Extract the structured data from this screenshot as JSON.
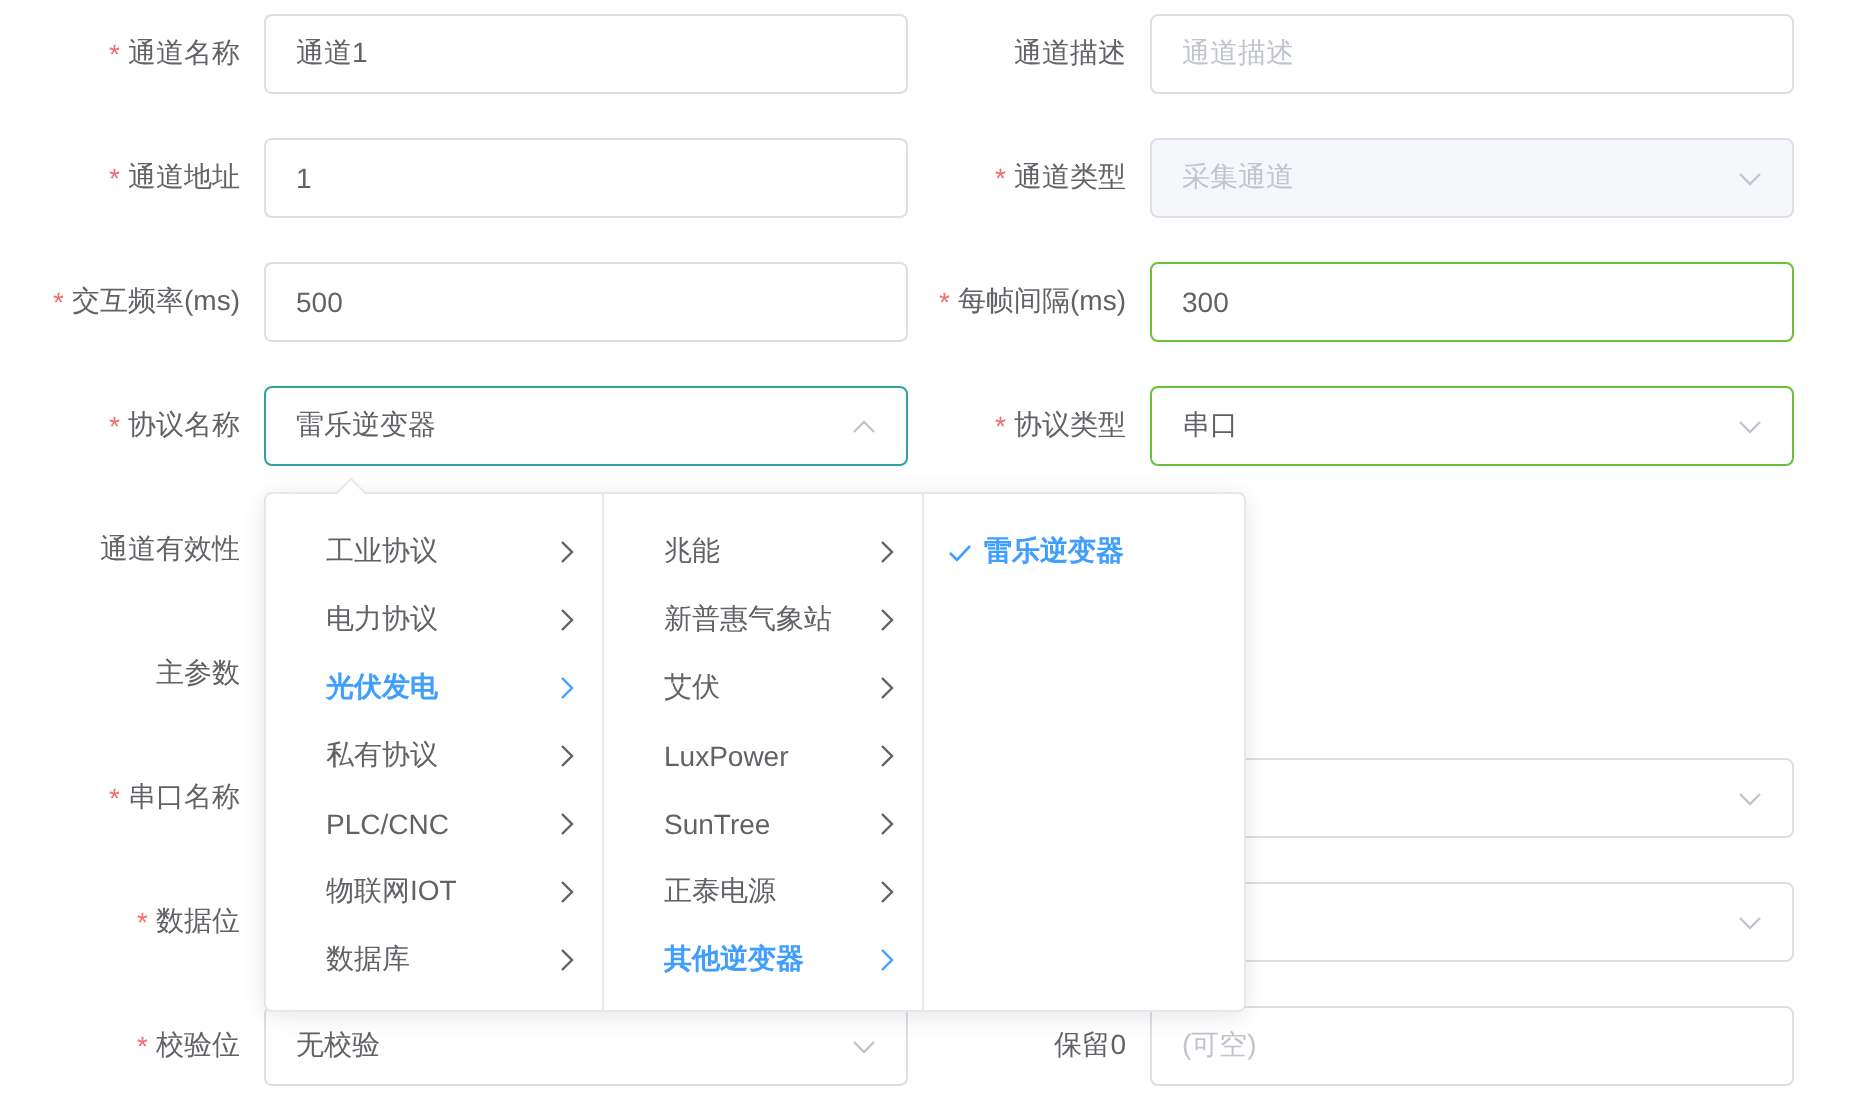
{
  "form": {
    "rows": [
      {
        "left": {
          "mark": "*",
          "label": "通道名称",
          "field": {
            "kind": "input",
            "value": "通道1",
            "valid": false,
            "open": false
          }
        },
        "right": {
          "label": "通道描述",
          "field": {
            "kind": "input",
            "placeholder": "通道描述",
            "valid": false,
            "open": false
          }
        }
      },
      {
        "left": {
          "mark": "*",
          "label": "通道地址",
          "field": {
            "kind": "input",
            "value": "1",
            "valid": false,
            "open": false
          }
        },
        "right": {
          "mark": "*",
          "label": "通道类型",
          "field": {
            "kind": "select",
            "value": "采集通道",
            "valid": false,
            "open": false,
            "disabled": true
          }
        }
      },
      {
        "left": {
          "mark": "*",
          "label": "交互频率(ms)",
          "field": {
            "kind": "input",
            "value": "500",
            "valid": false,
            "open": false
          }
        },
        "right": {
          "mark": "*",
          "label": "每帧间隔(ms)",
          "field": {
            "kind": "input",
            "value": "300",
            "valid": true,
            "open": false
          }
        }
      },
      {
        "left": {
          "mark": "*",
          "label": "协议名称",
          "field": {
            "kind": "select",
            "value": "雷乐逆变器",
            "valid": false,
            "open": true
          }
        },
        "right": {
          "mark": "*",
          "label": "协议类型",
          "field": {
            "kind": "select",
            "value": "串口",
            "valid": true,
            "open": false
          }
        }
      },
      {
        "left": {
          "label": "通道有效性"
        }
      },
      {
        "left": {
          "label": "主参数"
        }
      },
      {
        "left": {
          "mark": "*",
          "label": "串口名称"
        },
        "right": {
          "field": {
            "kind": "select",
            "valid": false,
            "open": false
          }
        }
      },
      {
        "left": {
          "mark": "*",
          "label": "数据位"
        },
        "right": {
          "field": {
            "kind": "select",
            "valid": false,
            "open": false
          }
        }
      },
      {
        "left": {
          "mark": "*",
          "label": "校验位",
          "field": {
            "kind": "select",
            "value": "无校验",
            "valid": false,
            "open": false
          }
        },
        "right": {
          "label": "保留0",
          "field": {
            "kind": "input",
            "placeholder": "(可空)",
            "valid": false,
            "open": false
          }
        }
      }
    ]
  },
  "cascader": {
    "columns": [
      {
        "items": [
          {
            "label": "工业协议",
            "kind": "branch",
            "selected": false
          },
          {
            "label": "电力协议",
            "kind": "branch",
            "selected": false
          },
          {
            "label": "光伏发电",
            "kind": "branch",
            "selected": true
          },
          {
            "label": "私有协议",
            "kind": "branch",
            "selected": false
          },
          {
            "label": "PLC/CNC",
            "kind": "branch",
            "selected": false
          },
          {
            "label": "物联网IOT",
            "kind": "branch",
            "selected": false
          },
          {
            "label": "数据库",
            "kind": "branch",
            "selected": false
          }
        ]
      },
      {
        "items": [
          {
            "label": "兆能",
            "kind": "branch",
            "selected": false
          },
          {
            "label": "新普惠气象站",
            "kind": "branch",
            "selected": false
          },
          {
            "label": "艾伏",
            "kind": "branch",
            "selected": false
          },
          {
            "label": "LuxPower",
            "kind": "branch",
            "selected": false
          },
          {
            "label": "SunTree",
            "kind": "branch",
            "selected": false
          },
          {
            "label": "正泰电源",
            "kind": "branch",
            "selected": false
          },
          {
            "label": "其他逆变器",
            "kind": "branch",
            "selected": true
          }
        ]
      },
      {
        "items": [
          {
            "label": "雷乐逆变器",
            "kind": "leaf",
            "selected": true
          }
        ]
      }
    ]
  }
}
